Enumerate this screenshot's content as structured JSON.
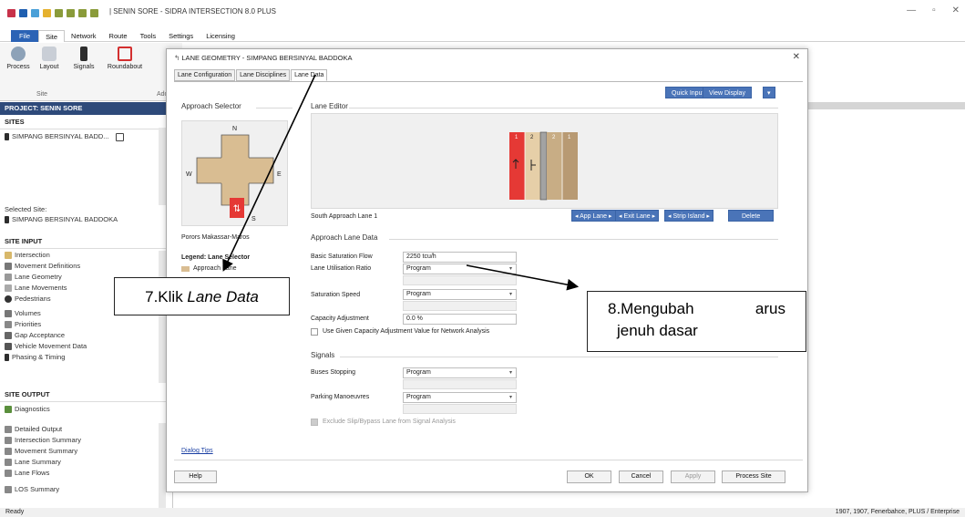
{
  "app": {
    "title": "| SENIN SORE - SIDRA INTERSECTION 8.0 PLUS"
  },
  "window_controls": {
    "minimize": "—",
    "maximize": "▫",
    "close": "✕"
  },
  "menu": [
    "File",
    "Site",
    "Network",
    "Route",
    "Tools",
    "Settings",
    "Licensing"
  ],
  "ribbon": {
    "buttons": [
      "Process",
      "Layout",
      "Signals",
      "Roundabout"
    ],
    "group_label": "Site",
    "group_label_2": "Adc"
  },
  "left_panel": {
    "project": "PROJECT: SENIN SORE",
    "sites_header": "SITES",
    "site_item": "SIMPANG BERSINYAL BADD...",
    "selected_site_label": "Selected Site:",
    "selected_site": "SIMPANG BERSINYAL BADDOKA",
    "site_input_header": "SITE INPUT",
    "site_input_items": [
      "Intersection",
      "Movement Definitions",
      "Lane Geometry",
      "Lane Movements",
      "Pedestrians",
      "Volumes",
      "Priorities",
      "Gap Acceptance",
      "Vehicle Movement Data",
      "Phasing & Timing"
    ],
    "site_output_header": "SITE OUTPUT",
    "site_output_items": [
      "Diagnostics",
      "Detailed Output",
      "Intersection Summary",
      "Movement Summary",
      "Lane Summary",
      "Lane Flows",
      "LOS Summary"
    ]
  },
  "dialog": {
    "title": "LANE GEOMETRY - SIMPANG BERSINYAL BADDOKA",
    "close": "✕",
    "tabs": [
      "Lane Configuration",
      "Lane Disciplines",
      "Lane Data"
    ],
    "quick_input": "Quick Input",
    "view_display": "View Display",
    "approach_selector": "Approach Selector",
    "compass": {
      "n": "N",
      "w": "W",
      "e": "E",
      "s": "S"
    },
    "approach_name": "Porors Makassar-Maros",
    "legend_title": "Legend: Lane Selector",
    "legend_item": "Approach Lane",
    "lane_editor": "Lane Editor",
    "lane_numbers": [
      "1",
      "2",
      "2",
      "1"
    ],
    "lane_label": "South Approach Lane 1",
    "lane_buttons": [
      "◂ App Lane ▸",
      "◂ Exit Lane ▸",
      "◂ Strip Island ▸"
    ],
    "delete": "Delete",
    "approach_lane_data": "Approach Lane Data",
    "fields": [
      {
        "label": "Basic Saturation Flow",
        "value": "2250 tcu/h",
        "dropdown": false
      },
      {
        "label": "Lane Utilisation Ratio",
        "value": "Program",
        "dropdown": true
      },
      {
        "label": "Saturation Speed",
        "value": "Program",
        "dropdown": true
      },
      {
        "label": "Capacity Adjustment",
        "value": "0.0 %",
        "dropdown": false
      }
    ],
    "use_capacity": "Use Given Capacity Adjustment Value for Network Analysis",
    "signals": "Signals",
    "signal_fields": [
      {
        "label": "Buses Stopping",
        "value": "Program"
      },
      {
        "label": "Parking Manoeuvres",
        "value": "Program"
      }
    ],
    "exclude": "Exclude Slip/Bypass Lane from Signal Analysis",
    "dialog_tips": "Dialog Tips",
    "help": "Help",
    "ok": "OK",
    "cancel": "Cancel",
    "apply": "Apply",
    "process_site": "Process Site"
  },
  "annotations": {
    "note7": "7.Klik Lane Data",
    "note7_prefix": "7.Klik ",
    "note7_em": "Lane Data",
    "note8_line1_a": "8.Mengubah",
    "note8_line1_b": "arus",
    "note8_line2": "jenuh dasar"
  },
  "status": {
    "left": "Ready",
    "right": "1907, 1907, Fenerbahce, PLUS / Enterprise"
  },
  "colors": {
    "accent": "#4a74b8",
    "red": "#e53935",
    "tan": "#d9bd92",
    "navy": "#2e4a7a"
  }
}
